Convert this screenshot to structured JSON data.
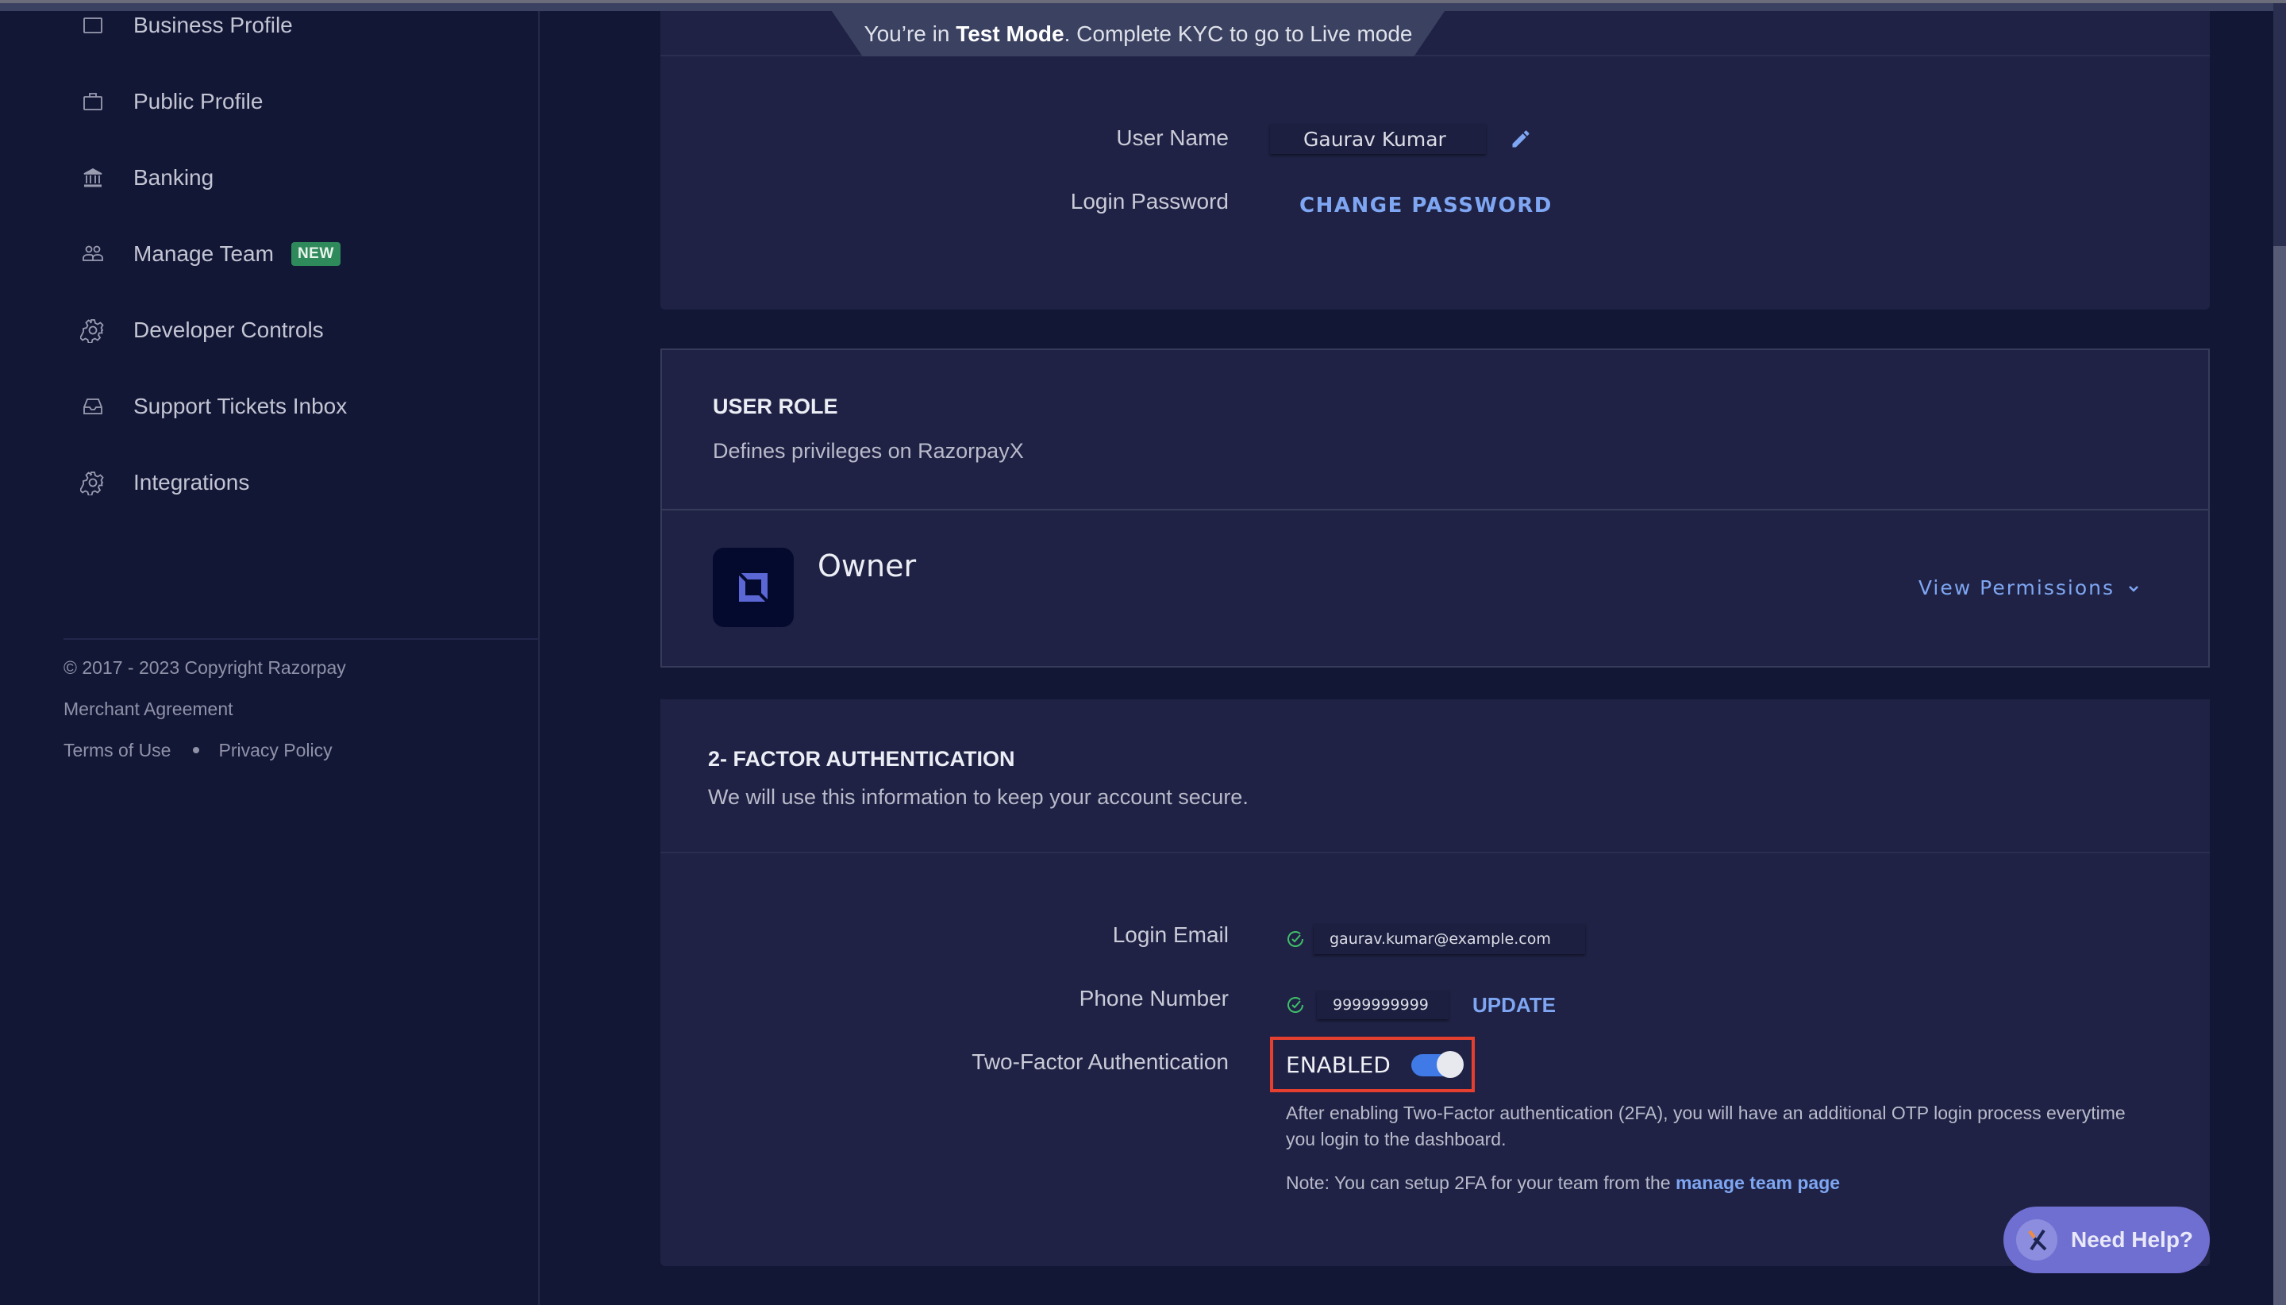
{
  "banner": {
    "prefix": "You’re in ",
    "mode": "Test Mode",
    "suffix": ". Complete KYC to go to Live mode"
  },
  "sidebar": {
    "items": [
      {
        "label": "Business Profile",
        "icon": "document-icon"
      },
      {
        "label": "Public Profile",
        "icon": "briefcase-icon"
      },
      {
        "label": "Banking",
        "icon": "bank-icon"
      },
      {
        "label": "Manage Team",
        "icon": "team-icon",
        "badge": "NEW"
      },
      {
        "label": "Developer Controls",
        "icon": "gear-icon"
      },
      {
        "label": "Support Tickets Inbox",
        "icon": "inbox-icon"
      },
      {
        "label": "Integrations",
        "icon": "gear-icon"
      }
    ],
    "footer": {
      "copyright": "© 2017 - 2023 Copyright Razorpay",
      "merchant_agreement": "Merchant Agreement",
      "terms": "Terms of Use",
      "privacy": "Privacy Policy"
    }
  },
  "account": {
    "user_name_label": "User Name",
    "user_name_value": "Gaurav Kumar",
    "login_password_label": "Login Password",
    "change_password": "CHANGE PASSWORD"
  },
  "user_role": {
    "title": "USER ROLE",
    "subtitle": "Defines privileges on RazorpayX",
    "role": "Owner",
    "view_permissions": "View Permissions"
  },
  "two_factor": {
    "title": "2- FACTOR AUTHENTICATION",
    "subtitle": "We will use this information to keep your account secure.",
    "login_email_label": "Login Email",
    "login_email_value": "gaurav.kumar@example.com",
    "phone_label": "Phone Number",
    "phone_value": "9999999999",
    "update": "UPDATE",
    "tfa_label": "Two-Factor Authentication",
    "tfa_status": "ENABLED",
    "tfa_enabled": true,
    "help_line1": "After enabling Two-Factor authentication (2FA), you will have an additional OTP login process everytime you login to the dashboard.",
    "note_prefix": "Note: You can setup 2FA for your team from the ",
    "note_link": "manage team page"
  },
  "help_widget": {
    "label": "Need Help?"
  },
  "colors": {
    "accent": "#7ea6f2",
    "toggle_on": "#3f7ae6",
    "badge_new": "#2f8a5b",
    "verified": "#3fbf6a",
    "highlight_box": "#e5402f",
    "help_button": "#6f6fd1"
  }
}
